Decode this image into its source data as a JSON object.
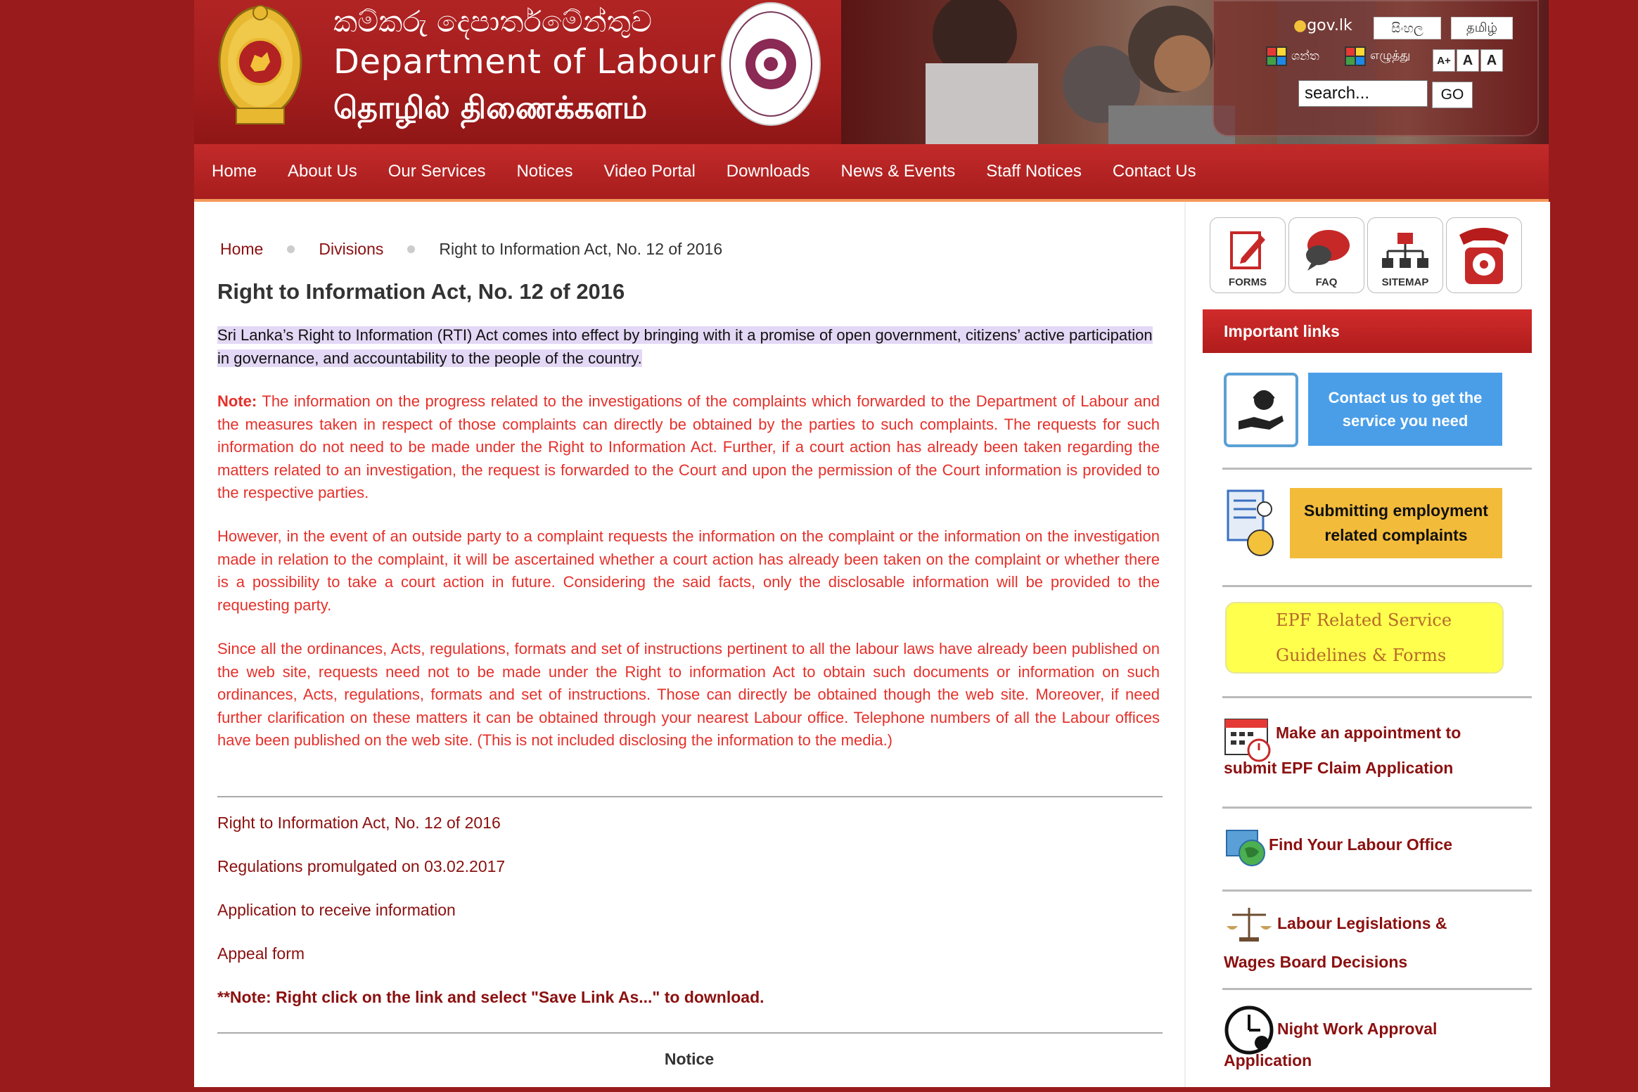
{
  "header": {
    "title_si": "කම්කරු දෙපාර්තමේන්තුව",
    "title_en": "Department of Labour",
    "title_ta": "தொழில் திணைக்களம்",
    "govlk": "gov.lk",
    "lang_si": "සිංහල",
    "lang_ta": "தமிழ்",
    "kb_si": "ශන්ත",
    "kb_ta": "எழுத்து",
    "font_plus": "A+",
    "font_normal": "A",
    "font_minus": "A",
    "search_value": "search...",
    "go_label": "GO"
  },
  "nav": {
    "items": [
      "Home",
      "About Us",
      "Our Services",
      "Notices",
      "Video Portal",
      "Downloads",
      "News & Events",
      "Staff Notices",
      "Contact Us"
    ]
  },
  "breadcrumb": {
    "home": "Home",
    "divisions": "Divisions",
    "current": "Right to Information Act, No. 12 of 2016"
  },
  "main": {
    "title": "Right to Information Act, No. 12 of 2016",
    "intro": "Sri Lanka’s Right to Information (RTI) Act comes into effect by bringing with it a promise of open government, citizens’ active participation in governance, and accountability to the people of the country.",
    "note_label": "Note:",
    "note_text": " The information on the progress related to the investigations of the complaints which forwarded to the Department of Labour and the measures taken in respect of those complaints can directly be obtained by the parties to such complaints. The requests for such information do not need to be made under the Right to Information Act. Further, if a court action has already been taken regarding the matters related to an investigation, the request is forwarded to the Court and upon the permission of the Court information is provided to the respective parties.",
    "para2": "However, in the event of an outside party to a complaint requests the information on the complaint or the information on the investigation made in relation to the complaint, it will be ascertained whether a court action has already been taken on the complaint or whether there is a possibility to take a court action in future. Considering the said facts, only the disclosable information will be provided to the requesting party.",
    "para3": "Since all the ordinances, Acts, regulations, formats and set of instructions pertinent to all the labour laws have already been published on the web site, requests need not to be made under the Right to information Act to obtain such documents or information on such ordinances, Acts, regulations, formats and set of instructions. Those can directly be obtained though the web site. Moreover, if need further clarification on these matters it can be obtained through your nearest Labour office. Telephone numbers of all the Labour offices have been published on the web site. (This is not included disclosing the information to the media.)",
    "links": [
      "Right to Information Act, No. 12 of 2016",
      "Regulations promulgated on 03.02.2017",
      "Application to receive information",
      "Appeal form"
    ],
    "download_note": "**Note: Right click on the link and select \"Save Link As...\" to download.",
    "notice_heading": "Notice"
  },
  "sidebar": {
    "quick": [
      "FORMS",
      "FAQ",
      "SITEMAP"
    ],
    "important_links": "Important links",
    "contact_line1": "Contact us to get the",
    "contact_line2": "service you need",
    "complaint_line1": "Submitting employment",
    "complaint_line2": "related complaints",
    "epf_line1": "EPF Related Service",
    "epf_line2": "Guidelines & Forms",
    "appointment_line1": "Make an appointment to",
    "appointment_line2": "submit EPF Claim Application",
    "find_office": "Find Your Labour Office",
    "legislation_line1": "Labour Legislations &",
    "legislation_line2": "Wages Board Decisions",
    "night_line1": "Night Work Approval",
    "night_line2": "Application"
  }
}
